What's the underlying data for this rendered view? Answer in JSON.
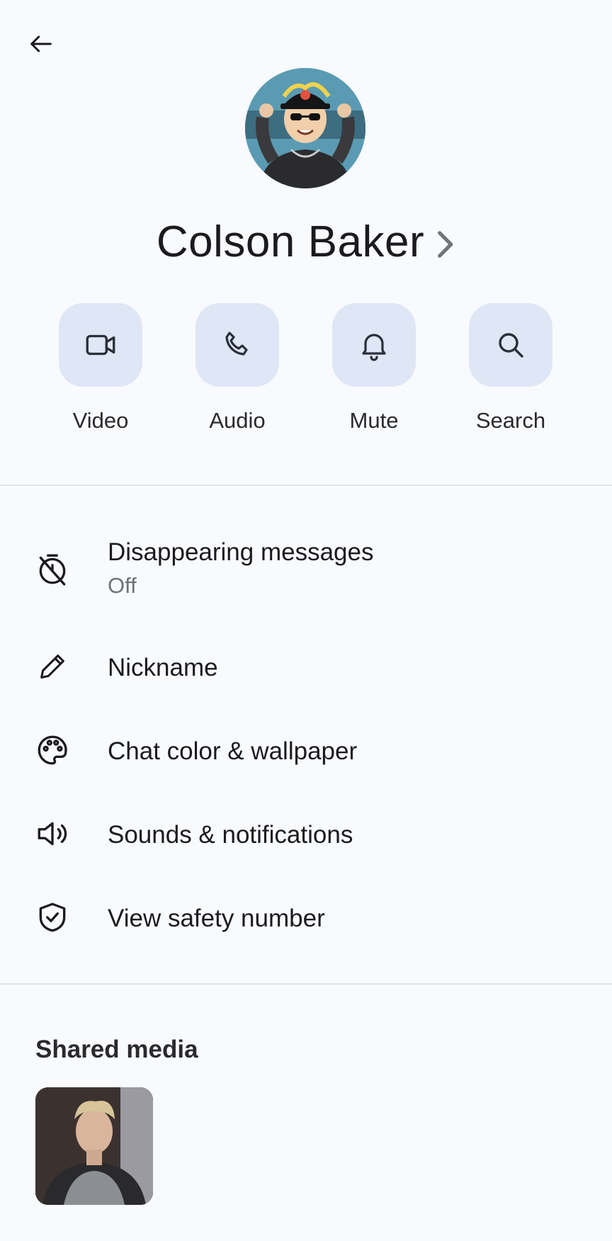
{
  "header": {
    "back_icon": "arrow-left-icon"
  },
  "profile": {
    "name": "Colson Baker",
    "avatar_icon": "cartoon-avatar",
    "chevron_icon": "chevron-right-icon"
  },
  "actions": [
    {
      "label": "Video",
      "icon": "video-camera-icon"
    },
    {
      "label": "Audio",
      "icon": "phone-icon"
    },
    {
      "label": "Mute",
      "icon": "bell-icon"
    },
    {
      "label": "Search",
      "icon": "search-icon"
    }
  ],
  "menu": {
    "disappearing": {
      "label": "Disappearing messages",
      "value": "Off",
      "icon": "timer-off-icon"
    },
    "nickname": {
      "label": "Nickname",
      "icon": "pencil-icon"
    },
    "chat_color": {
      "label": "Chat color & wallpaper",
      "icon": "palette-icon"
    },
    "sounds": {
      "label": "Sounds & notifications",
      "icon": "speaker-icon"
    },
    "safety": {
      "label": "View safety number",
      "icon": "shield-check-icon"
    }
  },
  "shared_media": {
    "title": "Shared media",
    "items": 1
  },
  "colors": {
    "tile_bg": "#dfe6f5",
    "page_bg": "#f8fafd",
    "divider": "#e1e3e8"
  }
}
